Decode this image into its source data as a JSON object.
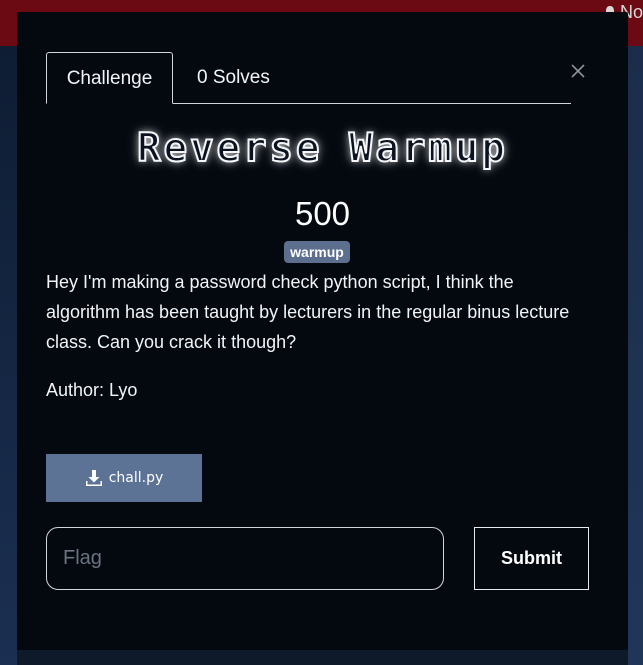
{
  "topbar": {
    "notifications_label": "No"
  },
  "tabs": [
    {
      "label": "Challenge",
      "active": true
    },
    {
      "label": "0 Solves",
      "active": false
    }
  ],
  "challenge": {
    "name": "Reverse Warmup",
    "points": "500",
    "tag": "warmup",
    "description": "Hey I'm making a password check python script, I think the algorithm has been taught by lecturers in the regular binus lecture class. Can you crack it though?",
    "author": "Author: Lyo",
    "file_label": "chall.py"
  },
  "form": {
    "flag_placeholder": "Flag",
    "flag_value": "",
    "submit_label": "Submit"
  },
  "icons": {
    "close": "close-icon",
    "download": "download-icon",
    "bell": "bell-icon"
  },
  "colors": {
    "modal_bg": "#040910",
    "tag_bg": "#5c6f8f",
    "download_bg": "#5c7396",
    "topbar_bg": "#6b0a12"
  }
}
